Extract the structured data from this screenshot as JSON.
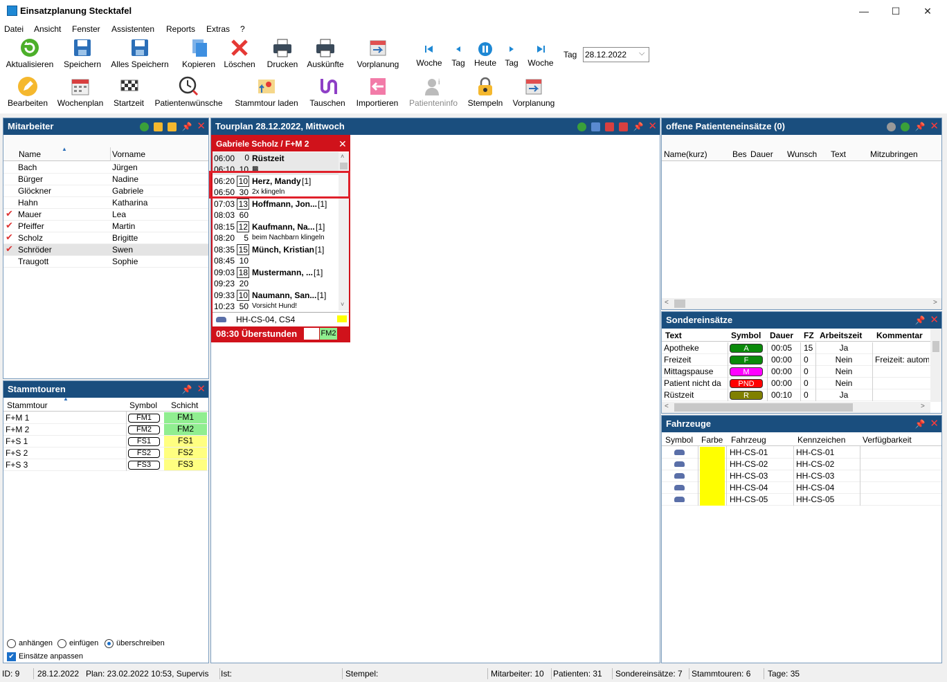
{
  "window": {
    "title": "Einsatzplanung Stecktafel",
    "min": "—",
    "max": "☐",
    "close": "✕"
  },
  "menu": [
    "Datei",
    "Ansicht",
    "Fenster",
    "Assistenten",
    "Reports",
    "Extras",
    "?"
  ],
  "toolbar1": {
    "buttons": [
      "Aktualisieren",
      "Speichern",
      "Alles Speichern",
      "Kopieren",
      "Löschen",
      "Drucken",
      "Auskünfte",
      "Vorplanung"
    ],
    "nav": [
      "Woche",
      "Tag",
      "Heute",
      "Tag",
      "Woche"
    ],
    "day_label": "Tag",
    "day_value": "28.12.2022"
  },
  "toolbar2": {
    "buttons": [
      "Bearbeiten",
      "Wochenplan",
      "Startzeit",
      "Patientenwünsche",
      "Stammtour laden",
      "Tauschen",
      "Importieren",
      "Patienteninfo",
      "Stempeln",
      "Vorplanung"
    ]
  },
  "mitarbeiter": {
    "title": "Mitarbeiter",
    "cols": [
      "Name",
      "Vorname"
    ],
    "rows": [
      {
        "name": "Bach",
        "vorname": "Jürgen",
        "check": ""
      },
      {
        "name": "Bürger",
        "vorname": "Nadine",
        "check": ""
      },
      {
        "name": "Glöckner",
        "vorname": "Gabriele",
        "check": ""
      },
      {
        "name": "Hahn",
        "vorname": "Katharina",
        "check": ""
      },
      {
        "name": "Mauer",
        "vorname": "Lea",
        "check": "✔"
      },
      {
        "name": "Pfeiffer",
        "vorname": "Martin",
        "check": "✔"
      },
      {
        "name": "Scholz",
        "vorname": "Brigitte",
        "check": "✔"
      },
      {
        "name": "Schröder",
        "vorname": "Swen",
        "check": "✔"
      },
      {
        "name": "Traugott",
        "vorname": "Sophie",
        "check": ""
      }
    ]
  },
  "stammtouren": {
    "title": "Stammtouren",
    "cols": [
      "Stammtour",
      "Symbol",
      "Schicht"
    ],
    "rows": [
      {
        "tour": "F+M 1",
        "symbol": "FM1",
        "schicht": "FM1",
        "color": "#90ee90"
      },
      {
        "tour": "F+M 2",
        "symbol": "FM2",
        "schicht": "FM2",
        "color": "#90ee90"
      },
      {
        "tour": "F+S 1",
        "symbol": "FS1",
        "schicht": "FS1",
        "color": "#ffff80"
      },
      {
        "tour": "F+S 2",
        "symbol": "FS2",
        "schicht": "FS2",
        "color": "#ffff80"
      },
      {
        "tour": "F+S 3",
        "symbol": "FS3",
        "schicht": "FS3",
        "color": "#ffff80"
      }
    ],
    "options": [
      "anhängen",
      "einfügen",
      "überschreiben"
    ],
    "checkbox": "Einsätze anpassen"
  },
  "tourplan": {
    "title": "Tourplan 28.12.2022, Mittwoch",
    "card": {
      "header": "Gabriele Scholz / F+M 2",
      "entries": [
        {
          "t1": "06:00",
          "d1": "0",
          "name": "Rüstzeit",
          "t2": "06:10",
          "d2": "10",
          "note": "▩"
        },
        {
          "t1": "06:20",
          "d1": "10",
          "name": "Herz, Mandy",
          "cnt": "[1]",
          "t2": "06:50",
          "d2": "30",
          "note": "2x klingeln"
        },
        {
          "t1": "07:03",
          "d1": "13",
          "name": "Hoffmann, Jon...",
          "cnt": "[1]",
          "t2": "08:03",
          "d2": "60",
          "note": ""
        },
        {
          "t1": "08:15",
          "d1": "12",
          "name": "Kaufmann, Na...",
          "cnt": "[1]",
          "t2": "08:20",
          "d2": "5",
          "note": "beim Nachbarn klingeln"
        },
        {
          "t1": "08:35",
          "d1": "15",
          "name": "Münch, Kristian",
          "cnt": "[1]",
          "t2": "08:45",
          "d2": "10",
          "note": ""
        },
        {
          "t1": "09:03",
          "d1": "18",
          "name": "Mustermann, ...",
          "cnt": "[1]",
          "t2": "09:23",
          "d2": "20",
          "note": ""
        },
        {
          "t1": "09:33",
          "d1": "10",
          "name": "Naumann, San...",
          "cnt": "[1]",
          "t2": "10:23",
          "d2": "50",
          "note": "Vorsicht Hund!"
        }
      ],
      "vehicle": "HH-CS-04, CS4",
      "overtime": "08:30 Überstunden",
      "shift": "FM2"
    }
  },
  "offene": {
    "title": "offene Patienteneinsätze (0)",
    "cols": [
      "Name(kurz)",
      "Bes",
      "Dauer",
      "Wunsch",
      "Text",
      "Mitzubringen"
    ]
  },
  "sonder": {
    "title": "Sondereinsätze",
    "cols": [
      "Text",
      "Symbol",
      "Dauer",
      "FZ",
      "Arbeitszeit",
      "Kommentar"
    ],
    "rows": [
      {
        "text": "Apotheke",
        "symbol": "A",
        "color": "#0a8a0a",
        "dauer": "00:05",
        "fz": "15",
        "az": "Ja",
        "komm": ""
      },
      {
        "text": "Freizeit",
        "symbol": "F",
        "color": "#0a8a0a",
        "dauer": "00:00",
        "fz": "0",
        "az": "Nein",
        "komm": "Freizeit: autom"
      },
      {
        "text": "Mittagspause",
        "symbol": "M",
        "color": "#ff00ff",
        "dauer": "00:00",
        "fz": "0",
        "az": "Nein",
        "komm": ""
      },
      {
        "text": "Patient nicht da",
        "symbol": "PND",
        "color": "#ff0000",
        "dauer": "00:00",
        "fz": "0",
        "az": "Nein",
        "komm": ""
      },
      {
        "text": "Rüstzeit",
        "symbol": "R",
        "color": "#808000",
        "dauer": "00:10",
        "fz": "0",
        "az": "Ja",
        "komm": ""
      }
    ]
  },
  "fahrzeuge": {
    "title": "Fahrzeuge",
    "cols": [
      "Symbol",
      "Farbe",
      "Fahrzeug",
      "Kennzeichen",
      "Verfügbarkeit"
    ],
    "rows": [
      {
        "fz": "HH-CS-01",
        "kz": "HH-CS-01"
      },
      {
        "fz": "HH-CS-02",
        "kz": "HH-CS-02"
      },
      {
        "fz": "HH-CS-03",
        "kz": "HH-CS-03"
      },
      {
        "fz": "HH-CS-04",
        "kz": "HH-CS-04"
      },
      {
        "fz": "HH-CS-05",
        "kz": "HH-CS-05"
      }
    ],
    "color": "#ffff00"
  },
  "status": {
    "id": "ID: 9",
    "date": "28.12.2022",
    "plan": "Plan: 23.02.2022 10:53, Supervis",
    "ist": "Ist:",
    "stempel": "Stempel:",
    "mitarbeiter": "Mitarbeiter: 10",
    "patienten": "Patienten: 31",
    "sonder": "Sondereinsätze: 7",
    "stammtouren": "Stammtouren: 6",
    "tage": "Tage: 35"
  }
}
